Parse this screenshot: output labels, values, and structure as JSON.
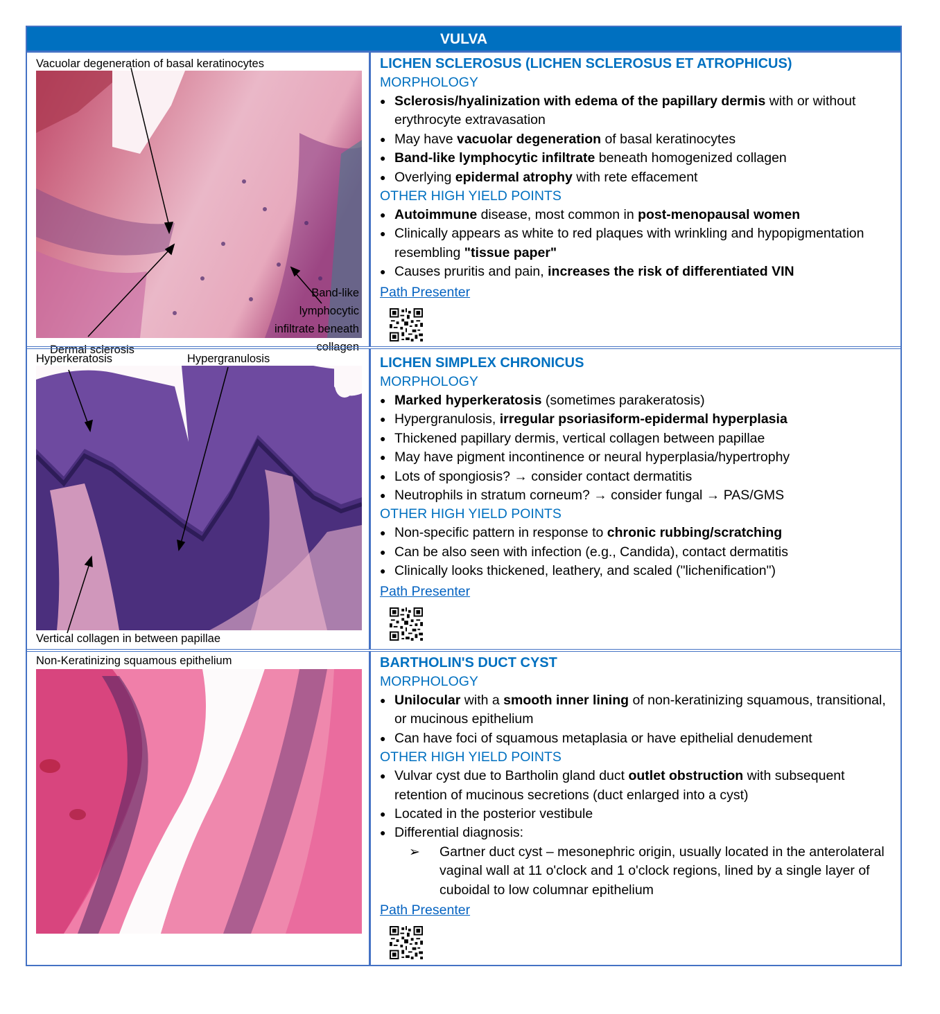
{
  "banner": "VULVA",
  "sections": [
    {
      "captions": [
        "Vacuolar degeneration of basal keratinocytes",
        "Dermal sclerosis",
        "Band-like",
        "lymphocytic",
        "infiltrate beneath",
        "collagen"
      ],
      "title": "LICHEN SCLEROSUS (LICHEN SCLEROSUS ET ATROPHICUS)",
      "morph_label": "MORPHOLOGY",
      "morph": [
        [
          {
            "t": "Sclerosis/hyalinization with edema of the papillary dermis",
            "b": true
          },
          {
            "t": " with or without erythrocyte extravasation"
          }
        ],
        [
          {
            "t": "May have "
          },
          {
            "t": "vacuolar degeneration",
            "b": true
          },
          {
            "t": " of basal keratinocytes"
          }
        ],
        [
          {
            "t": "Band-like lymphocytic infiltrate",
            "b": true
          },
          {
            "t": " beneath homogenized collagen"
          }
        ],
        [
          {
            "t": "Overlying "
          },
          {
            "t": "epidermal atrophy",
            "b": true
          },
          {
            "t": " with rete effacement"
          }
        ]
      ],
      "other_label": "OTHER HIGH YIELD POINTS",
      "other": [
        [
          {
            "t": "Autoimmune",
            "b": true
          },
          {
            "t": " disease, most common in "
          },
          {
            "t": "post-menopausal women",
            "b": true
          }
        ],
        [
          {
            "t": "Clinically appears as white to red plaques with wrinkling and hypopigmentation resembling "
          },
          {
            "t": "\"tissue paper\"",
            "b": true
          }
        ],
        [
          {
            "t": "Causes pruritis and pain, "
          },
          {
            "t": "increases the risk of differentiated VIN",
            "b": true
          }
        ]
      ],
      "link": "Path Presenter"
    },
    {
      "captions": [
        "Hyperkeratosis",
        "Hypergranulosis",
        "Vertical collagen in between papillae"
      ],
      "title": "LICHEN SIMPLEX CHRONICUS",
      "morph_label": "MORPHOLOGY",
      "morph": [
        [
          {
            "t": "Marked hyperkeratosis",
            "b": true
          },
          {
            "t": " (sometimes parakeratosis)"
          }
        ],
        [
          {
            "t": "Hypergranulosis, "
          },
          {
            "t": "irregular psoriasiform-epidermal hyperplasia",
            "b": true
          }
        ],
        [
          {
            "t": "Thickened papillary dermis, vertical collagen between papillae"
          }
        ],
        [
          {
            "t": "May have pigment incontinence or neural hyperplasia/hypertrophy"
          }
        ],
        [
          {
            "t": "Lots of spongiosis? → consider contact dermatitis"
          }
        ],
        [
          {
            "t": "Neutrophils in stratum corneum? → consider fungal → PAS/GMS"
          }
        ]
      ],
      "other_label": "OTHER HIGH YIELD POINTS",
      "other": [
        [
          {
            "t": "Non-specific pattern in response to "
          },
          {
            "t": "chronic rubbing/scratching",
            "b": true
          }
        ],
        [
          {
            "t": "Can be also seen with infection (e.g., Candida), contact dermatitis"
          }
        ],
        [
          {
            "t": "Clinically looks thickened, leathery, and scaled (\"lichenification\")"
          }
        ]
      ],
      "link": "Path Presenter"
    },
    {
      "captions": [
        "Non-Keratinizing squamous epithelium"
      ],
      "title": "BARTHOLIN'S DUCT CYST",
      "morph_label": "MORPHOLOGY",
      "morph": [
        [
          {
            "t": "Unilocular",
            "b": true
          },
          {
            "t": " with a "
          },
          {
            "t": "smooth inner lining",
            "b": true
          },
          {
            "t": " of non-keratinizing squamous, transitional, or mucinous epithelium"
          }
        ],
        [
          {
            "t": "Can have foci of squamous metaplasia or have epithelial denudement"
          }
        ]
      ],
      "other_label": "OTHER HIGH YIELD POINTS",
      "other": [
        [
          {
            "t": "Vulvar cyst due to Bartholin gland duct "
          },
          {
            "t": "outlet obstruction",
            "b": true
          },
          {
            "t": " with subsequent retention of mucinous secretions (duct enlarged into a cyst)"
          }
        ],
        [
          {
            "t": "Located in the posterior vestibule"
          }
        ],
        [
          {
            "t": "Differential diagnosis:"
          }
        ]
      ],
      "sub_bullets": [
        [
          {
            "t": "Gartner duct cyst –  mesonephric origin, usually located in the anterolateral vaginal wall at 11 o'clock and 1 o'clock regions, lined by a single layer of cuboidal to low columnar epithelium"
          }
        ]
      ],
      "link": "Path Presenter"
    }
  ]
}
